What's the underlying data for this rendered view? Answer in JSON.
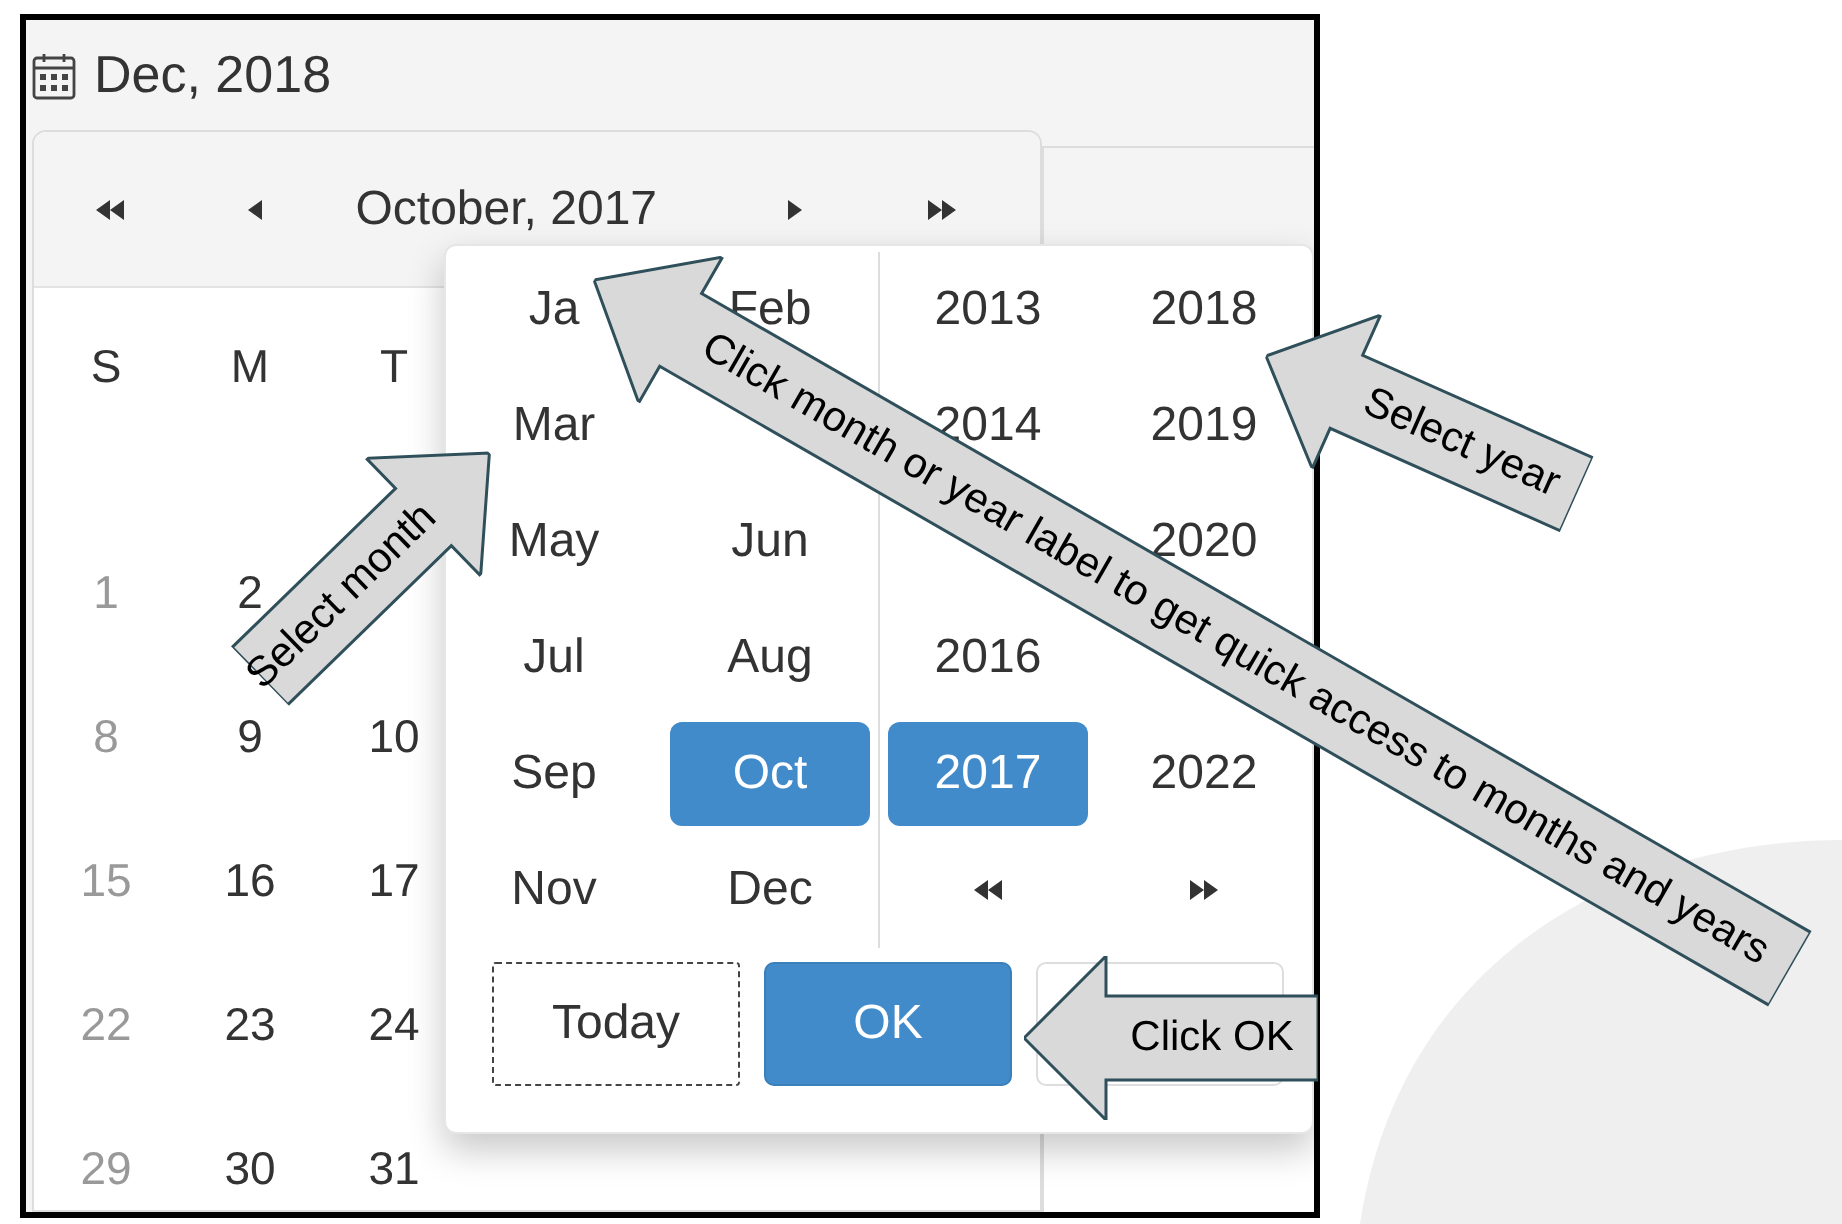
{
  "date_field": {
    "value": "Dec, 2018"
  },
  "calendar": {
    "title": "October, 2017",
    "weekdays": [
      "S",
      "M",
      "T"
    ],
    "weeks": [
      {
        "days": [
          {
            "text": "1",
            "weekend": true
          },
          {
            "text": "2",
            "weekend": false
          }
        ]
      },
      {
        "days": [
          {
            "text": "8",
            "weekend": true
          },
          {
            "text": "9",
            "weekend": false
          },
          {
            "text": "10",
            "weekend": false
          }
        ]
      },
      {
        "days": [
          {
            "text": "15",
            "weekend": true
          },
          {
            "text": "16",
            "weekend": false
          },
          {
            "text": "17",
            "weekend": false
          }
        ]
      },
      {
        "days": [
          {
            "text": "22",
            "weekend": true
          },
          {
            "text": "23",
            "weekend": false
          },
          {
            "text": "24",
            "weekend": false
          }
        ]
      },
      {
        "days": [
          {
            "text": "29",
            "weekend": true
          },
          {
            "text": "30",
            "weekend": false
          },
          {
            "text": "31",
            "weekend": false
          }
        ]
      }
    ]
  },
  "picker": {
    "month_rows": [
      {
        "left": {
          "label": "Ja",
          "selected": false
        },
        "right": {
          "label": "Feb",
          "selected": false
        }
      },
      {
        "left": {
          "label": "Mar",
          "selected": false
        }
      },
      {
        "left": {
          "label": "May",
          "selected": false
        },
        "right": {
          "label": "Jun",
          "selected": false
        }
      },
      {
        "left": {
          "label": "Jul",
          "selected": false
        },
        "right": {
          "label": "Aug",
          "selected": false
        }
      },
      {
        "left": {
          "label": "Sep",
          "selected": false
        },
        "right": {
          "label": "Oct",
          "selected": true
        }
      },
      {
        "left": {
          "label": "Nov",
          "selected": false
        },
        "right": {
          "label": "Dec",
          "selected": false
        }
      }
    ],
    "year_rows": [
      {
        "left": {
          "label": "2013",
          "selected": false
        },
        "right": {
          "label": "2018",
          "selected": false
        }
      },
      {
        "left": {
          "label": "2014",
          "selected": false
        },
        "right": {
          "label": "2019",
          "selected": false
        }
      },
      {
        "right": {
          "label": "2020",
          "selected": false
        }
      },
      {
        "left": {
          "label": "2016",
          "selected": false
        }
      },
      {
        "left": {
          "label": "2017",
          "selected": true
        },
        "right": {
          "label": "2022",
          "selected": false
        }
      }
    ],
    "buttons": [
      {
        "label": "Today",
        "kind": "focused"
      },
      {
        "label": "OK",
        "kind": "primary"
      },
      {
        "kind": "plain"
      }
    ]
  },
  "annotations": [
    {
      "text": "Click month or year label to get quick access to months and years"
    },
    {
      "text": "Select month"
    },
    {
      "text": "Select year"
    },
    {
      "text": "Click OK"
    }
  ]
}
